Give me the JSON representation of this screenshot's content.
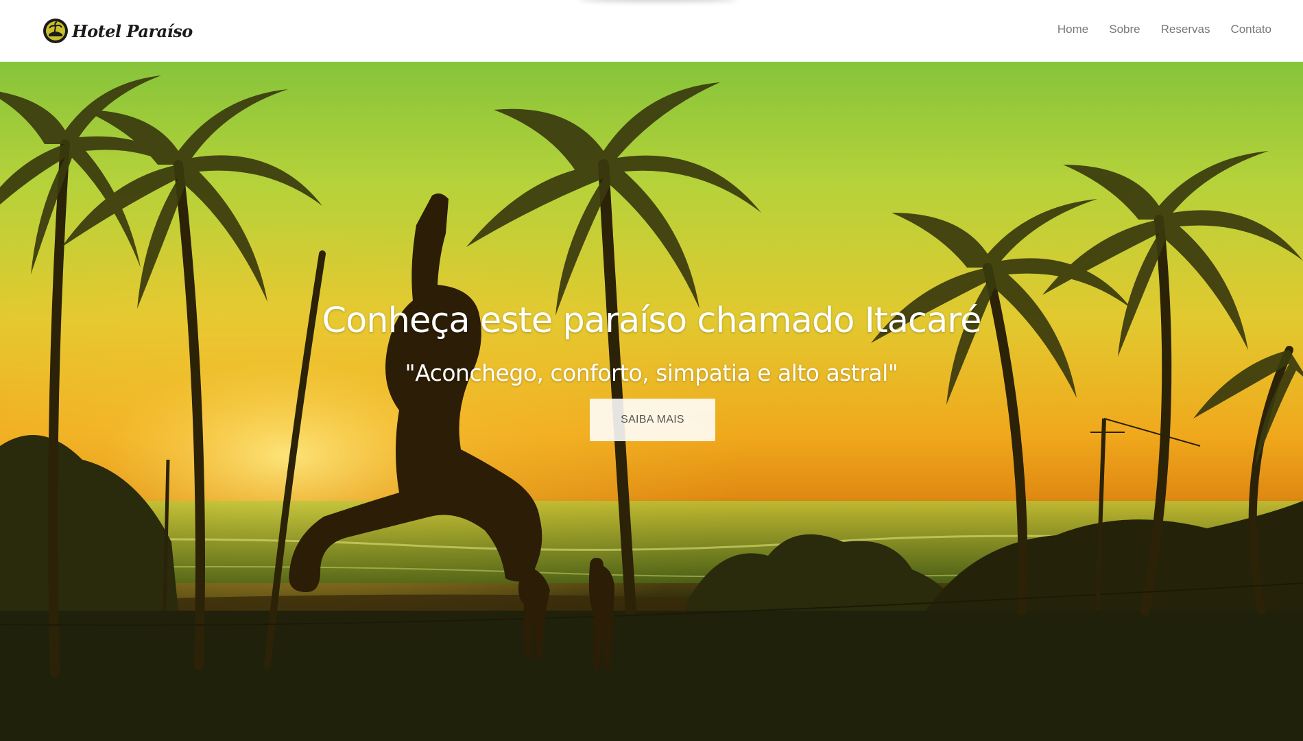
{
  "brand": {
    "name": "Hotel Paraíso",
    "logo_icon": "hotel-logo-icon"
  },
  "nav": {
    "items": [
      {
        "label": "Home"
      },
      {
        "label": "Sobre"
      },
      {
        "label": "Reservas"
      },
      {
        "label": "Contato"
      }
    ]
  },
  "hero": {
    "title": "Conheça este paraíso chamado Itacaré",
    "subtitle": "\"Aconchego, conforto, simpatia e alto astral\"",
    "button_label": "SAIBA MAIS",
    "background": "sunset-beach-palm-trees-slackline-photo"
  },
  "colors": {
    "navbar_bg": "#ffffff",
    "nav_text": "#777777",
    "hero_text": "#ffffff",
    "sky_top": "#86c43a",
    "sky_mid": "#e6c52d",
    "horizon": "#f09a18",
    "ground": "#1e200b"
  }
}
